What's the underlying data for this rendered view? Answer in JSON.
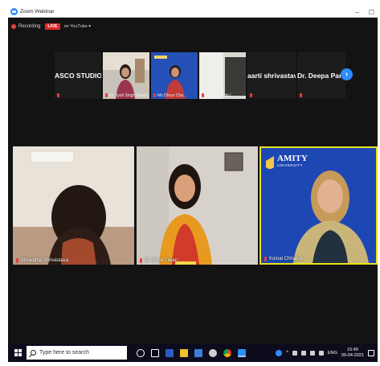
{
  "window": {
    "title": "Zoom Webinar",
    "controls": {
      "minimize": "–",
      "maximize": "☐"
    }
  },
  "recording": {
    "label": "Recording",
    "live_badge": "LIVE",
    "stream_target": "on YouTube ▾"
  },
  "filmstrip": {
    "tiles": [
      {
        "type": "name",
        "name": "ASCO STUDIO"
      },
      {
        "type": "video",
        "caption": "Dr. Jyoti Singh Bandan"
      },
      {
        "type": "video",
        "caption": "Ms Dhruv Cha..."
      },
      {
        "type": "video",
        "caption": "Col S K Seth (..."
      },
      {
        "type": "name",
        "name": "aarti shrivastava"
      },
      {
        "type": "name",
        "name": "Dr. Deepa Pandey"
      }
    ],
    "next_label": "›"
  },
  "gallery": {
    "tiles": [
      {
        "caption": "Shraddha Shrivastava",
        "active": false
      },
      {
        "caption": "Dr Shruti Tiwari",
        "active": false
      },
      {
        "caption": "Komal Chhabra",
        "active": true,
        "background_text": "AMITY",
        "background_subtext": "UNIVERSITY"
      }
    ]
  },
  "taskbar": {
    "search_placeholder": "Type here to search",
    "language": "ENG",
    "time": "15:49",
    "date": "09-04-2021"
  },
  "colors": {
    "zoom_blue": "#2d8cff",
    "live_red": "#e02929",
    "active_speaker": "#e7e21d",
    "amity_blue": "#1a3d9c"
  }
}
